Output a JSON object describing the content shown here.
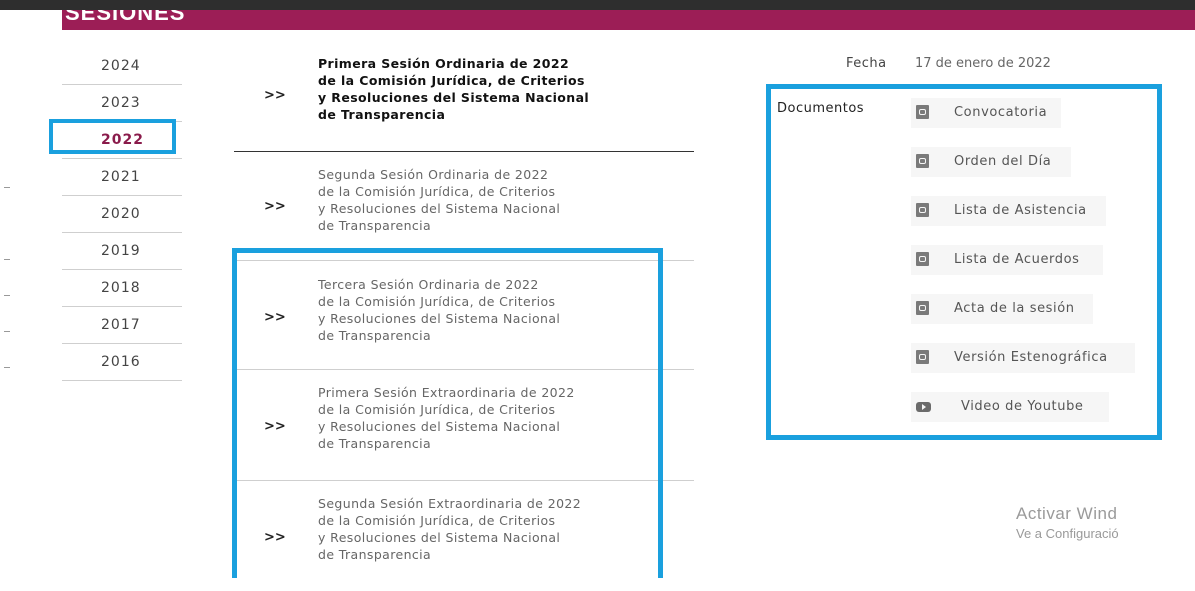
{
  "header": {
    "title": "SESIONES"
  },
  "years": [
    "2024",
    "2023",
    "2022",
    "2021",
    "2020",
    "2019",
    "2018",
    "2017",
    "2016"
  ],
  "active_year": "2022",
  "sessions": [
    {
      "arrow": ">>",
      "title": "Primera Sesión Ordinaria de 2022\nde la Comisión Jurídica, de Criterios\ny Resoluciones del Sistema Nacional\nde Transparencia"
    },
    {
      "arrow": ">>",
      "title": "Segunda Sesión Ordinaria de 2022\nde la Comisión Jurídica, de Criterios\ny Resoluciones del Sistema Nacional\nde Transparencia"
    },
    {
      "arrow": ">>",
      "title": "Tercera Sesión Ordinaria de 2022\nde la Comisión Jurídica, de Criterios\ny Resoluciones del Sistema Nacional\nde Transparencia"
    },
    {
      "arrow": ">>",
      "title": "Primera Sesión Extraordinaria de 2022\nde la Comisión Jurídica, de Criterios\ny Resoluciones del Sistema Nacional\nde Transparencia"
    },
    {
      "arrow": ">>",
      "title": "Segunda Sesión Extraordinaria de 2022\nde la Comisión Jurídica, de Criterios\ny Resoluciones del Sistema Nacional\nde Transparencia"
    }
  ],
  "detail": {
    "fecha_label": "Fecha",
    "fecha_value": "17 de enero de 2022",
    "docs_label": "Documentos",
    "documents": [
      {
        "label": "Convocatoria",
        "icon": "pdf-icon"
      },
      {
        "label": "Orden del Día",
        "icon": "pdf-icon"
      },
      {
        "label": "Lista de Asistencia",
        "icon": "pdf-icon"
      },
      {
        "label": "Lista de Acuerdos",
        "icon": "pdf-icon"
      },
      {
        "label": "Acta de la sesión",
        "icon": "pdf-icon"
      },
      {
        "label": "Versión Estenográfica",
        "icon": "pdf-icon"
      },
      {
        "label": "Video de Youtube",
        "icon": "video-icon"
      }
    ]
  },
  "watermark": {
    "line1": "Activar Wind",
    "line2": "Ve a Configuració"
  },
  "colors": {
    "brand": "#9c1e56",
    "active_year": "#8a1b4b",
    "highlight": "#1aa0de"
  }
}
